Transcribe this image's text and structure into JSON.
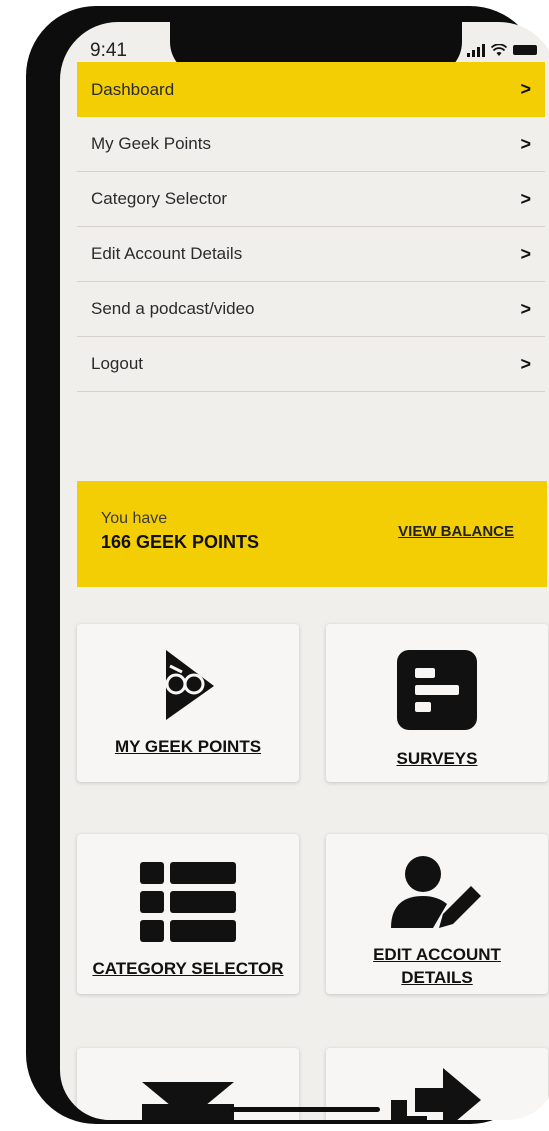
{
  "status_bar": {
    "time": "9:41"
  },
  "menu": {
    "items": [
      {
        "label": "Dashboard",
        "chevron": ">"
      },
      {
        "label": "My Geek Points",
        "chevron": ">"
      },
      {
        "label": "Category Selector",
        "chevron": ">"
      },
      {
        "label": "Edit Account Details",
        "chevron": ">"
      },
      {
        "label": "Send a podcast/video",
        "chevron": ">"
      },
      {
        "label": "Logout",
        "chevron": ">"
      }
    ]
  },
  "points_banner": {
    "prefix": "You have",
    "points": "166 GEEK POINTS",
    "link": "VIEW BALANCE"
  },
  "tiles": [
    {
      "label": "MY GEEK POINTS",
      "icon": "play-glasses-icon"
    },
    {
      "label": "SURVEYS",
      "icon": "survey-icon"
    },
    {
      "label": "CATEGORY SELECTOR",
      "icon": "list-icon"
    },
    {
      "label_line1": "EDIT ACCOUNT",
      "label_line2": "DETAILS",
      "icon": "user-edit-icon"
    },
    {
      "label": "",
      "icon": "envelope-icon"
    },
    {
      "label": "",
      "icon": "arrow-right-icon"
    }
  ],
  "colors": {
    "accent": "#f4ce05",
    "background": "#f1efec",
    "text": "#111111"
  }
}
